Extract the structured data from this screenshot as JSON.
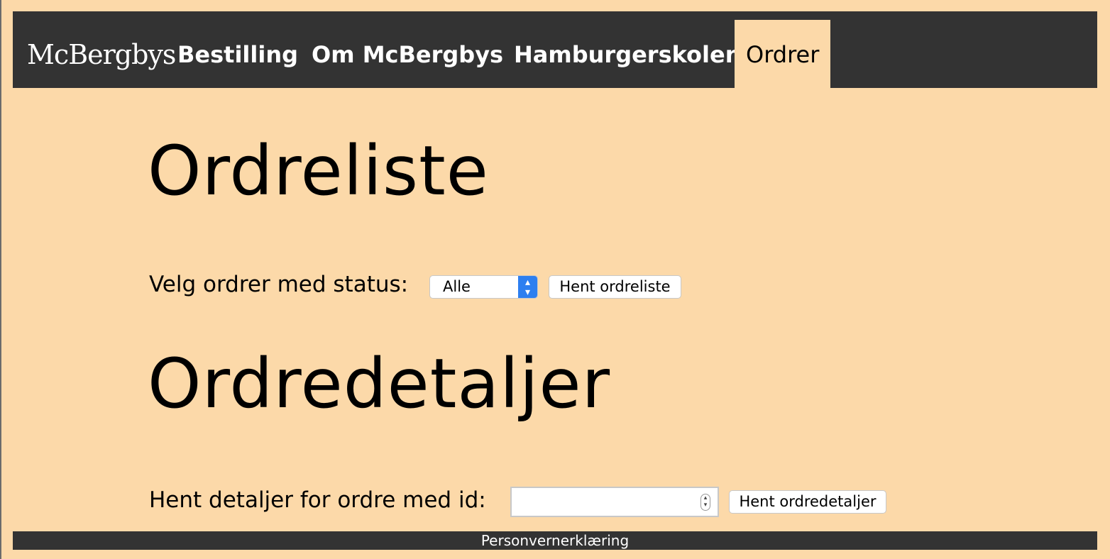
{
  "nav": {
    "logo": "McBergbys",
    "links": [
      "Bestilling",
      "Om McBergbys",
      "Hamburgerskolen",
      "Ordrer"
    ]
  },
  "order_list": {
    "title": "Ordreliste",
    "status_label": "Velg ordrer med status:",
    "status_selected": "Alle",
    "fetch_button": "Hent ordreliste"
  },
  "order_details": {
    "title": "Ordredetaljer",
    "id_label": "Hent detaljer for ordre med id:",
    "id_value": "",
    "fetch_button": "Hent ordredetaljer"
  },
  "footer": {
    "link": "Personvernerklæring"
  },
  "colors": {
    "background": "#fcd9a9",
    "navbar": "#333333",
    "select_accent": "#2d7ff0"
  }
}
